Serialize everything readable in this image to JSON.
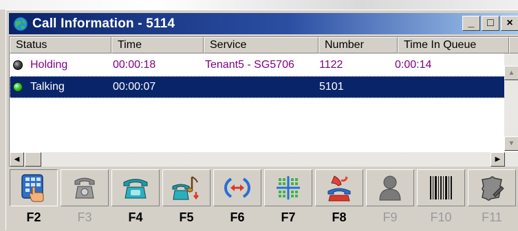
{
  "window": {
    "title": "Call Information - 5114",
    "controls": {
      "minimize": "_",
      "maximize": "□",
      "close": "×"
    }
  },
  "list": {
    "columns": [
      "Status",
      "Time",
      "Service",
      "Number",
      "Time In Queue"
    ],
    "rows": [
      {
        "status": "Holding",
        "status_icon": "led-dark-icon",
        "time": "00:00:18",
        "service": "Tenant5 - SG5706",
        "number": "1122",
        "time_in_queue": "0:00:14",
        "selected": false
      },
      {
        "status": "Talking",
        "status_icon": "led-green-icon",
        "time": "00:00:07",
        "service": "",
        "number": "5101",
        "time_in_queue": "",
        "selected": true
      }
    ]
  },
  "toolbar": {
    "buttons": [
      {
        "key": "F2",
        "icon": "dialpad-hand-icon",
        "enabled": true,
        "pressed": true
      },
      {
        "key": "F3",
        "icon": "phone-gray-icon",
        "enabled": false
      },
      {
        "key": "F4",
        "icon": "phone-teal-icon",
        "enabled": true
      },
      {
        "key": "F5",
        "icon": "phone-music-hold-icon",
        "enabled": true
      },
      {
        "key": "F6",
        "icon": "transfer-arrows-icon",
        "enabled": true
      },
      {
        "key": "F7",
        "icon": "conference-grid-icon",
        "enabled": true
      },
      {
        "key": "F8",
        "icon": "hangup-phone-icon",
        "enabled": true
      },
      {
        "key": "F9",
        "icon": "person-silhouette-icon",
        "enabled": false
      },
      {
        "key": "F10",
        "icon": "barcode-icon",
        "enabled": false
      },
      {
        "key": "F11",
        "icon": "puzzle-tool-icon",
        "enabled": false
      }
    ]
  },
  "colors": {
    "title_start": "#0a246a",
    "title_end": "#a6caf0",
    "holding_text": "#800080",
    "selection": "#0a246a",
    "phone_teal": "#1e9aa8",
    "dialpad_blue": "#2f6fc4"
  }
}
